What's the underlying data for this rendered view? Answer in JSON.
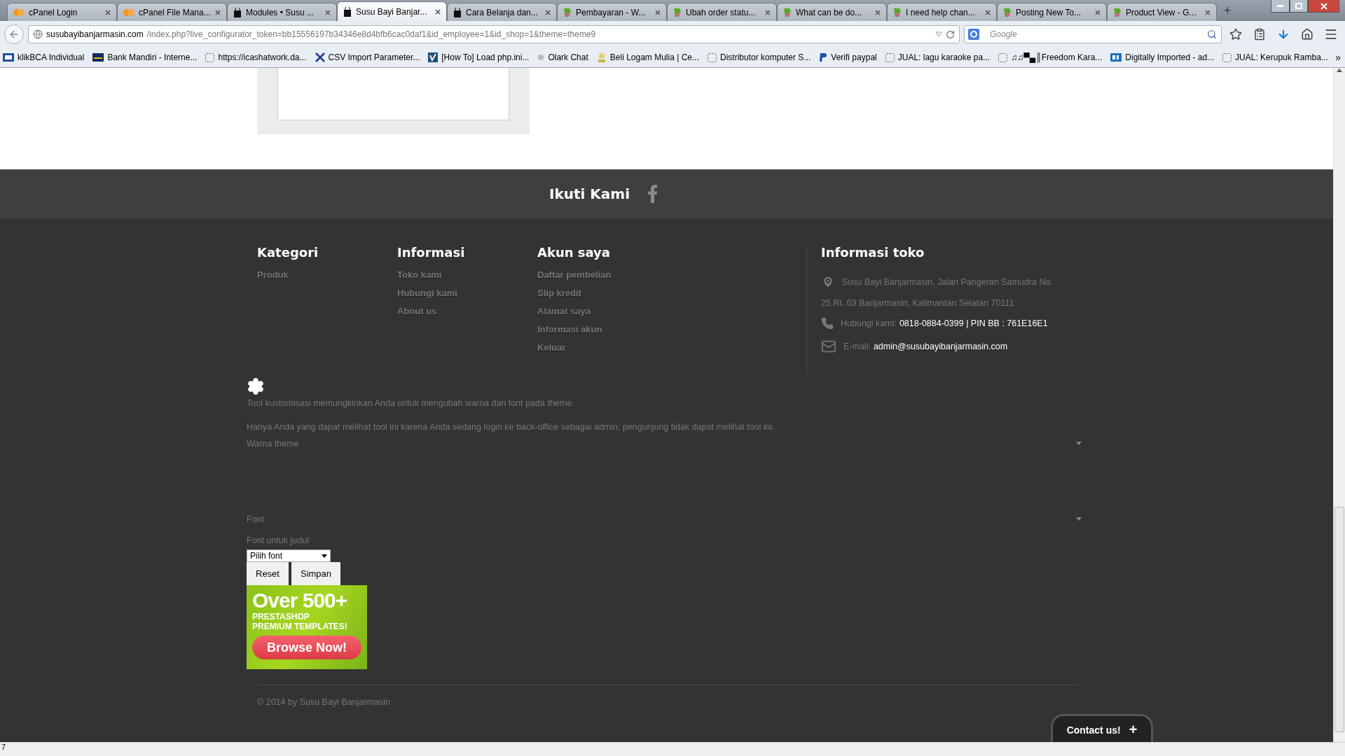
{
  "browser": {
    "tabs": [
      {
        "title": "cPanel Login",
        "kind": "cpanel",
        "selected": false
      },
      {
        "title": "cPanel File Mana...",
        "kind": "cpanel",
        "selected": false
      },
      {
        "title": "Modules • Susu ...",
        "kind": "shop",
        "selected": false
      },
      {
        "title": "Susu Bayi Banjar...",
        "kind": "shop",
        "selected": true
      },
      {
        "title": "Cara Belanja dan...",
        "kind": "shop",
        "selected": false
      },
      {
        "title": "Pembayaran - W...",
        "kind": "forum",
        "selected": false
      },
      {
        "title": "Ubah order statu...",
        "kind": "forum",
        "selected": false
      },
      {
        "title": "What can be do...",
        "kind": "forum",
        "selected": false
      },
      {
        "title": "I need help chan...",
        "kind": "forum",
        "selected": false
      },
      {
        "title": "Posting New To...",
        "kind": "forum",
        "selected": false
      },
      {
        "title": "Product View - G...",
        "kind": "forum",
        "selected": false
      }
    ],
    "new_tab": "+",
    "url": {
      "domain": "susubayibanjarmasin.com",
      "path": "/index.php?live_configurator_token=bb15556197b34346e8d4bfb6cac0daf1&id_employee=1&id_shop=1&theme=theme9"
    },
    "search": {
      "placeholder": "Google"
    },
    "bookmarks": [
      {
        "label": "klikBCA Individual",
        "kind": "bank"
      },
      {
        "label": "Bank Mandiri - Interne...",
        "kind": "card"
      },
      {
        "label": "https://icashatwork.da...",
        "kind": "blank"
      },
      {
        "label": "CSV Import Parameter...",
        "kind": "tools"
      },
      {
        "label": "[How To] Load php.ini...",
        "kind": "check"
      },
      {
        "label": "Olark Chat",
        "kind": "dot"
      },
      {
        "label": "Beli Logam Mulia | Ce...",
        "kind": "gold"
      },
      {
        "label": "Distributor komputer S...",
        "kind": "blank"
      },
      {
        "label": "Verifi paypal",
        "kind": "paypal"
      },
      {
        "label": "JUAL: lagu karaoke pa...",
        "kind": "blank"
      },
      {
        "label": "♫♫▀▄║Freedom Kara...",
        "kind": "blank"
      },
      {
        "label": "Digitally Imported - ad...",
        "kind": "di"
      },
      {
        "label": "JUAL: Kerupuk Ramba...",
        "kind": "blank"
      }
    ],
    "more_bookmarks": "»",
    "status": "7"
  },
  "page": {
    "follow": {
      "title": "Ikuti Kami"
    },
    "columns": [
      {
        "heading": "Kategori",
        "links": [
          "Produk"
        ]
      },
      {
        "heading": "Informasi",
        "links": [
          "Toko kami",
          "Hubungi kami",
          "About us"
        ]
      },
      {
        "heading": "Akun saya",
        "links": [
          "Daftar pembelian",
          "Slip kredit",
          "Alamat saya",
          "Informasi akun",
          "Keluar"
        ]
      }
    ],
    "store_info": {
      "heading": "Informasi toko",
      "address_line_1": "Susu Bayi Banjarmasin, Jalan Pangeran Samudra No.",
      "address_line_2": "25 Rt. 03 Banjarmasin, Kalimantan Selatan 70111",
      "phone_label": "Hubungi kami:",
      "phone": "0818-0884-0399 | PIN BB : 761E16E1",
      "email_label": "E-mail:",
      "email": "admin@susubayibanjarmasin.com"
    },
    "customizer": {
      "intro": "Tool kustomisasi memungkinkan Anda untuk mengubah warna dan font pada theme.",
      "note": "Hanya Anda yang dapat melihat tool ini karena Anda sedang login ke back-office sebagai admin; pengunjung tidak dapat melihat tool ini.",
      "sections": [
        {
          "title": "Warna theme",
          "expanded": false
        },
        {
          "title": "Font",
          "expanded": false
        }
      ],
      "font_label": "Font untuk judul",
      "font_select": "Pilih font",
      "buttons": [
        "Reset",
        "Simpan"
      ]
    },
    "banner": {
      "headline": "Over 500+",
      "subline_1": "PRESTASHOP",
      "subline_2": "PREMIUM TEMPLATES!",
      "button": "Browse Now!"
    },
    "copyright": "© 2014 by Susu Bayi Banjarmasin",
    "contact": {
      "label": "Contact us!",
      "icon": "+"
    }
  }
}
